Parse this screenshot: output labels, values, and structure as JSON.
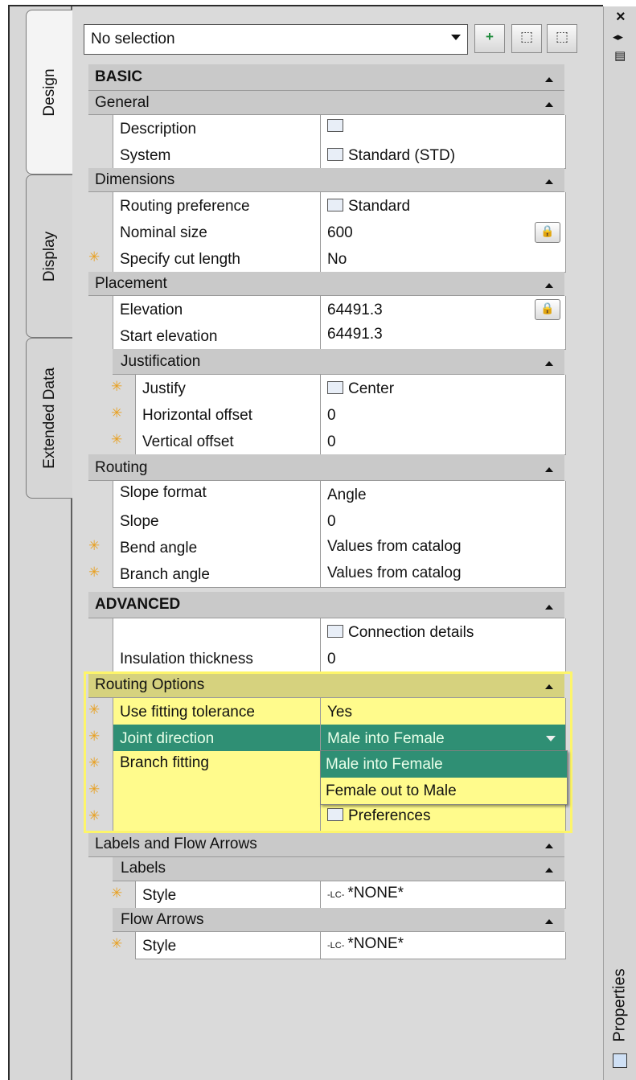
{
  "selector": {
    "value": "No selection"
  },
  "toolbar": {
    "btn1": "+",
    "btn2": "⬚",
    "btn3": "⬚"
  },
  "window_controls": {
    "close": "×",
    "pin": "◂▸",
    "menu": "▤",
    "props_icon": "▦"
  },
  "tabs": {
    "design": "Design",
    "display": "Display",
    "extended": "Extended Data",
    "palette_title": "Properties"
  },
  "sections": {
    "basic": "BASIC",
    "general": "General",
    "dimensions": "Dimensions",
    "placement": "Placement",
    "justification": "Justification",
    "routing": "Routing",
    "advanced": "ADVANCED",
    "routing_options": "Routing Options",
    "labels_flow": "Labels and Flow Arrows",
    "labels": "Labels",
    "flow_arrows": "Flow Arrows"
  },
  "rows": {
    "description": {
      "label": "Description",
      "value": ""
    },
    "system": {
      "label": "System",
      "value": "Standard (STD)"
    },
    "routing_pref": {
      "label": "Routing preference",
      "value": "Standard"
    },
    "nominal_size": {
      "label": "Nominal size",
      "value": "600"
    },
    "cut_length": {
      "label": "Specify cut length",
      "value": "No"
    },
    "elevation": {
      "label": "Elevation",
      "value": "64491.3"
    },
    "start_elev": {
      "label": "Start elevation",
      "value": "64491.3"
    },
    "justify": {
      "label": "Justify",
      "value": "Center"
    },
    "h_offset": {
      "label": "Horizontal offset",
      "value": "0"
    },
    "v_offset": {
      "label": "Vertical offset",
      "value": "0"
    },
    "slope_format": {
      "label": "Slope format",
      "value": "Angle"
    },
    "slope": {
      "label": "Slope",
      "value": "0"
    },
    "bend_angle": {
      "label": "Bend angle",
      "value": "Values from catalog"
    },
    "branch_angle": {
      "label": "Branch angle",
      "value": "Values from catalog"
    },
    "conn_details": {
      "label": "",
      "value": "Connection details"
    },
    "insulation": {
      "label": "Insulation thickness",
      "value": "0"
    },
    "fit_tol": {
      "label": "Use fitting tolerance",
      "value": "Yes"
    },
    "joint_dir": {
      "label": "Joint direction",
      "value": "Male into Female"
    },
    "branch_fit": {
      "label": "Branch fitting",
      "value": ""
    },
    "preferences": {
      "label": "",
      "value": "Preferences"
    },
    "labels_style": {
      "label": "Style",
      "value": "*NONE*"
    },
    "flow_style": {
      "label": "Style",
      "value": "*NONE*"
    }
  },
  "dropdown_options": [
    "Male into Female",
    "Female out to Male"
  ],
  "style_prefix": "-LC-",
  "star": "✳",
  "lock": "🔒",
  "colors": {
    "highlight": "#2f8f74",
    "yellow": "#fffb8c",
    "star": "#e8a020"
  }
}
